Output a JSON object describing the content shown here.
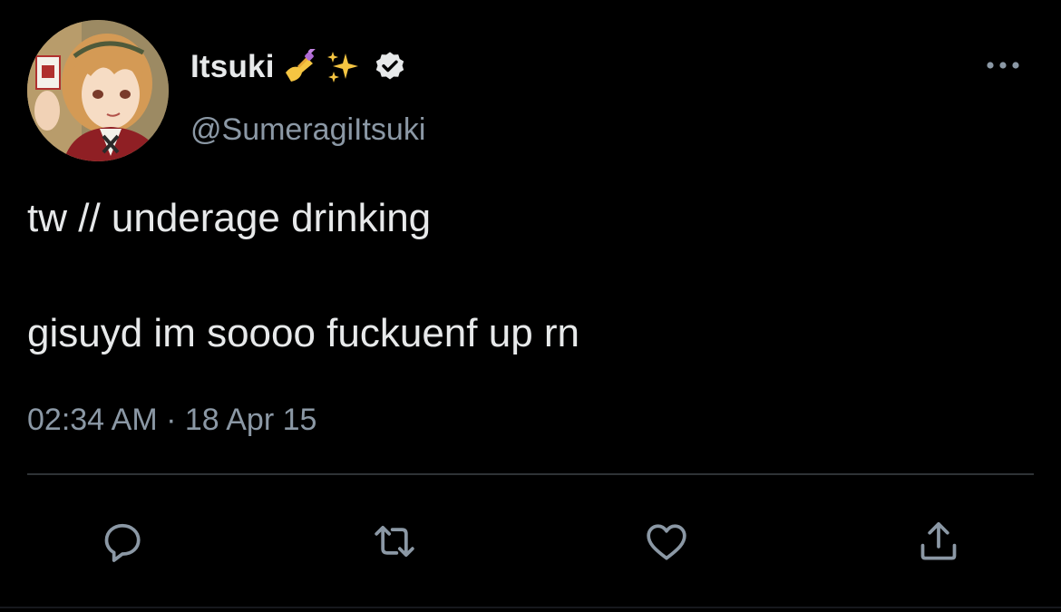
{
  "user": {
    "display_name": "Itsuki",
    "name_emojis": [
      "nail-polish-icon",
      "sparkles-icon"
    ],
    "verified": true,
    "handle": "@SumeragiItsuki",
    "avatar": "anime-character-avatar"
  },
  "tweet": {
    "line1": "tw // underage drinking",
    "line2": "gisuyd im soooo fuckuenf up rn",
    "timestamp": "02:34 AM · 18 Apr 15"
  },
  "actions": [
    "reply-icon",
    "retweet-icon",
    "like-icon",
    "share-icon"
  ],
  "colors": {
    "background": "#000000",
    "text": "#e7e9ea",
    "secondary": "#8b98a5",
    "divider": "#2f3336"
  }
}
